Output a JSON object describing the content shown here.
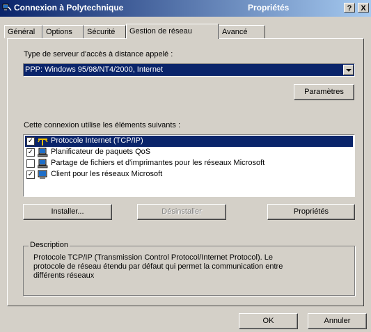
{
  "window": {
    "title_left": "Connexion à Polytechnique",
    "title_right": "Propriétés",
    "help_button": "?",
    "close_button": "X"
  },
  "tabs": [
    {
      "label": "Général",
      "active": false
    },
    {
      "label": "Options",
      "active": false
    },
    {
      "label": "Sécurité",
      "active": false
    },
    {
      "label": "Gestion de réseau",
      "active": true
    },
    {
      "label": "Avancé",
      "active": false
    }
  ],
  "server_type": {
    "label": "Type de serveur d'accès à distance appelé :",
    "selected": "PPP: Windows 95/98/NT4/2000, Internet"
  },
  "settings_button": "Paramètres",
  "components": {
    "label": "Cette connexion utilise les éléments suivants :",
    "items": [
      {
        "label": "Protocole Internet (TCP/IP)",
        "checked": true,
        "selected": true,
        "icon": "protocol-icon"
      },
      {
        "label": "Planificateur de paquets QoS",
        "checked": true,
        "selected": false,
        "icon": "service-icon"
      },
      {
        "label": "Partage de fichiers et d'imprimantes pour les réseaux Microsoft",
        "checked": false,
        "selected": false,
        "icon": "service-icon"
      },
      {
        "label": "Client pour les réseaux Microsoft",
        "checked": true,
        "selected": false,
        "icon": "client-icon"
      }
    ]
  },
  "buttons": {
    "install": "Installer...",
    "uninstall": "Désinstaller",
    "properties": "Propriétés",
    "ok": "OK",
    "cancel": "Annuler"
  },
  "description": {
    "title": "Description",
    "text": "Protocole TCP/IP (Transmission Control Protocol/Internet Protocol). Le protocole de réseau étendu par défaut qui permet la communication entre différents réseaux"
  },
  "colors": {
    "face": "#d4d0c8",
    "selection": "#0a246a",
    "titlebar_start": "#0a246a",
    "titlebar_end": "#a6caf0"
  }
}
